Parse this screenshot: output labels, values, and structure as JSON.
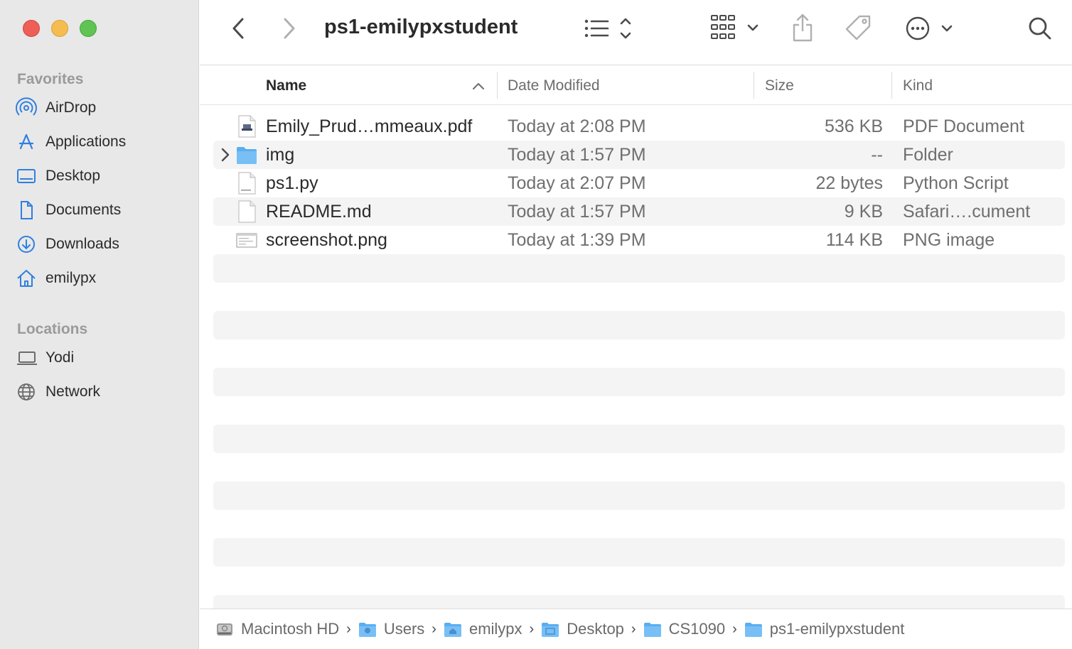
{
  "window": {
    "title": "ps1-emilypxstudent"
  },
  "sidebar": {
    "favorites_label": "Favorites",
    "favorites": [
      {
        "label": "AirDrop",
        "icon": "airdrop-icon"
      },
      {
        "label": "Applications",
        "icon": "applications-icon"
      },
      {
        "label": "Desktop",
        "icon": "desktop-icon"
      },
      {
        "label": "Documents",
        "icon": "document-icon"
      },
      {
        "label": "Downloads",
        "icon": "downloads-icon"
      },
      {
        "label": "emilypx",
        "icon": "home-icon"
      }
    ],
    "locations_label": "Locations",
    "locations": [
      {
        "label": "Yodi",
        "icon": "laptop-icon"
      },
      {
        "label": "Network",
        "icon": "globe-icon"
      }
    ]
  },
  "columns": {
    "name": "Name",
    "date": "Date Modified",
    "size": "Size",
    "kind": "Kind"
  },
  "files": [
    {
      "name": "Emily_Prud…mmeaux.pdf",
      "date": "Today at 2:08 PM",
      "size": "536 KB",
      "kind": "PDF Document",
      "icon": "pdf-file-icon"
    },
    {
      "name": "img",
      "date": "Today at 1:57 PM",
      "size": "--",
      "kind": "Folder",
      "icon": "folder-icon"
    },
    {
      "name": "ps1.py",
      "date": "Today at 2:07 PM",
      "size": "22 bytes",
      "kind": "Python Script",
      "icon": "python-file-icon"
    },
    {
      "name": "README.md",
      "date": "Today at 1:57 PM",
      "size": "9 KB",
      "kind": "Safari….cument",
      "icon": "text-file-icon"
    },
    {
      "name": "screenshot.png",
      "date": "Today at 1:39 PM",
      "size": "114 KB",
      "kind": "PNG image",
      "icon": "image-file-icon"
    }
  ],
  "path": [
    {
      "label": "Macintosh HD",
      "icon": "hard-drive-icon"
    },
    {
      "label": "Users",
      "icon": "users-folder-icon"
    },
    {
      "label": "emilypx",
      "icon": "home-folder-icon"
    },
    {
      "label": "Desktop",
      "icon": "desktop-folder-icon"
    },
    {
      "label": "CS1090",
      "icon": "folder-icon"
    },
    {
      "label": "ps1-emilypxstudent",
      "icon": "folder-icon"
    }
  ],
  "colors": {
    "accent": "#2f7fe0",
    "sidebar_bg": "#e8e8e8",
    "folder_blue": "#5aaef0"
  }
}
